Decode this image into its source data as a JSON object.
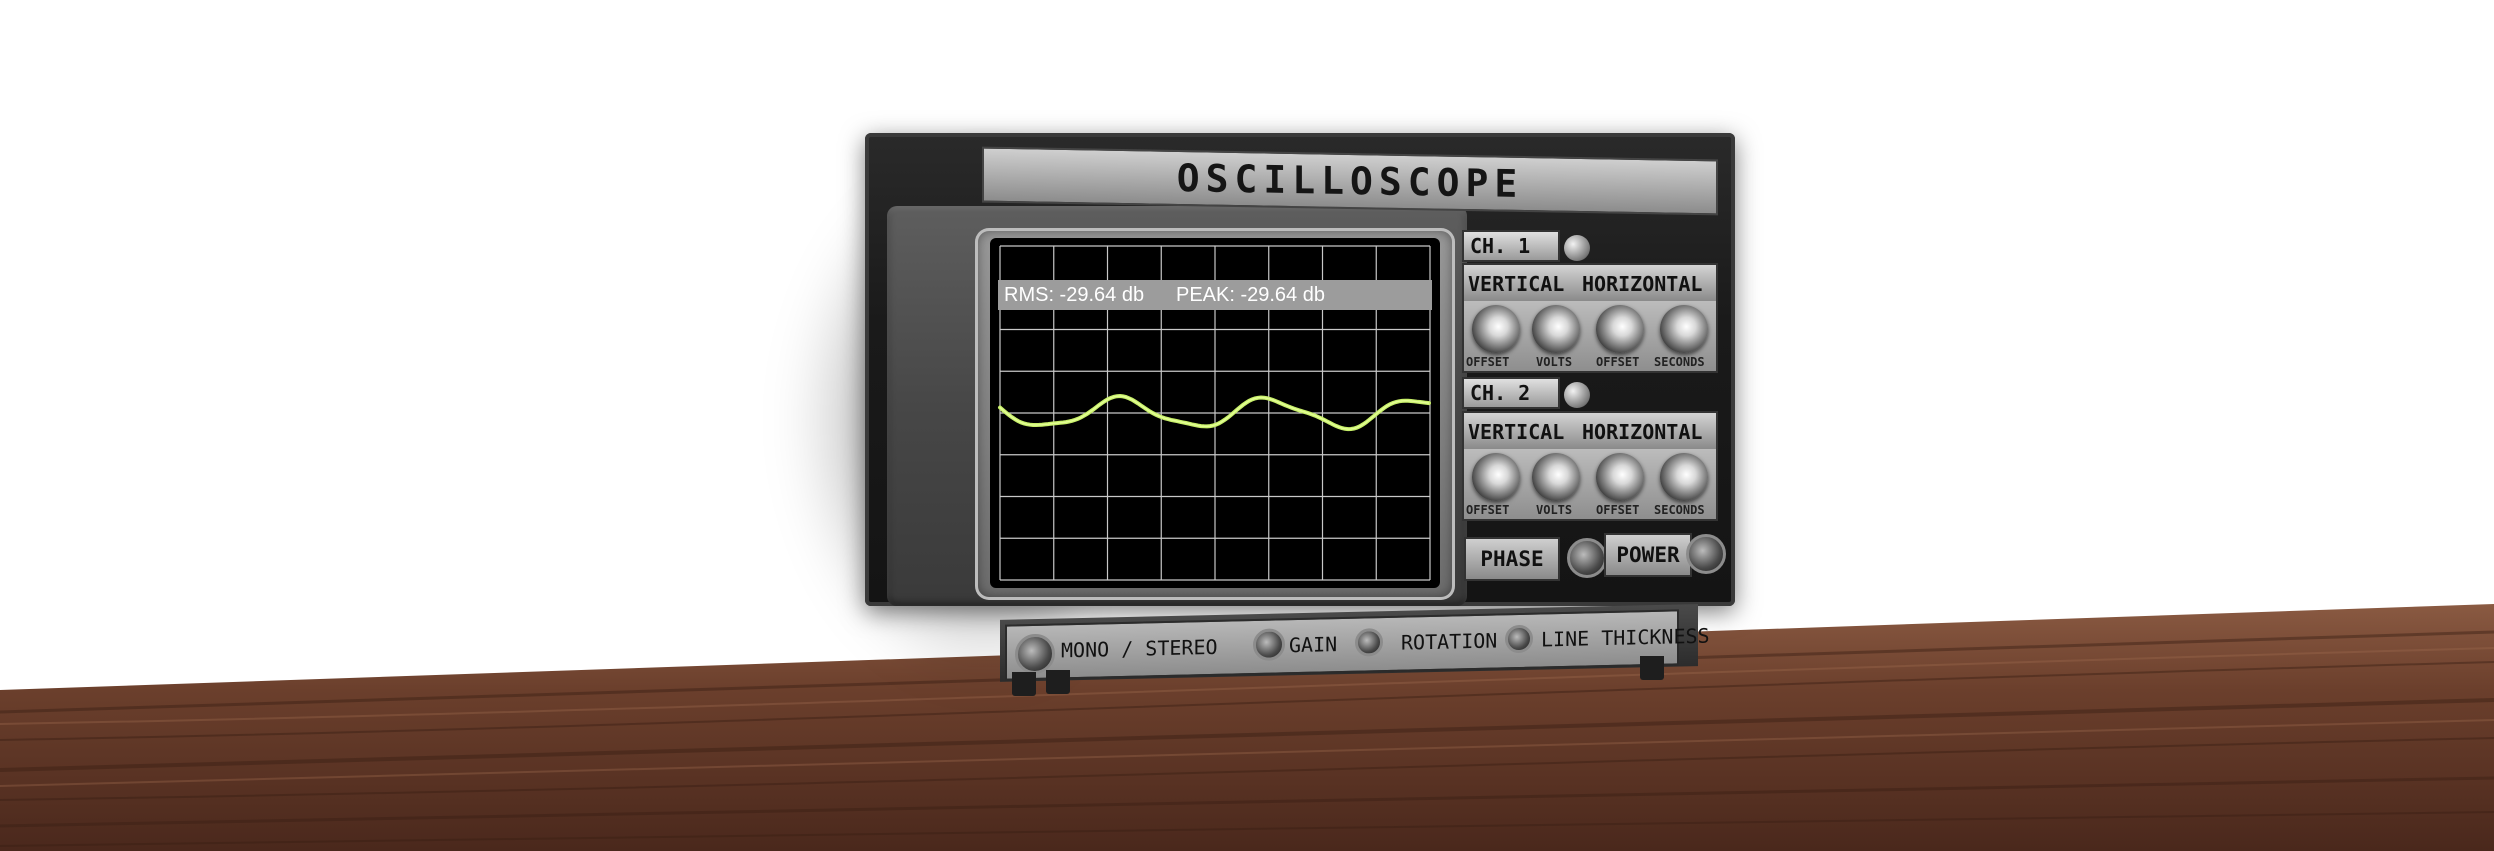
{
  "device": {
    "title": "OSCILLOSCOPE"
  },
  "display": {
    "rms_readout": "RMS: -29.64 db",
    "peak_readout": "PEAK: -29.64 db",
    "trace_color": "#c8f06a",
    "grid_color": "#c8c8c8"
  },
  "channels": [
    {
      "label": "CH. 1",
      "vertical_label": "VERTICAL",
      "horizontal_label": "HORIZONTAL",
      "knobs": [
        "OFFSET",
        "VOLTS",
        "OFFSET",
        "SECONDS"
      ]
    },
    {
      "label": "CH. 2",
      "vertical_label": "VERTICAL",
      "horizontal_label": "HORIZONTAL",
      "knobs": [
        "OFFSET",
        "VOLTS",
        "OFFSET",
        "SECONDS"
      ]
    }
  ],
  "buttons": {
    "phase": "PHASE",
    "power": "POWER"
  },
  "bottom_controls": {
    "mono_stereo": "MONO / STEREO",
    "gain": "GAIN",
    "rotation": "ROTATION",
    "line_thickness": "LINE THICKNESS"
  },
  "colors": {
    "wood_dark": "#3a2016",
    "wood_light": "#7a4a34",
    "body": "#1c1c1c",
    "panel_silver": "#b8b8b8"
  }
}
